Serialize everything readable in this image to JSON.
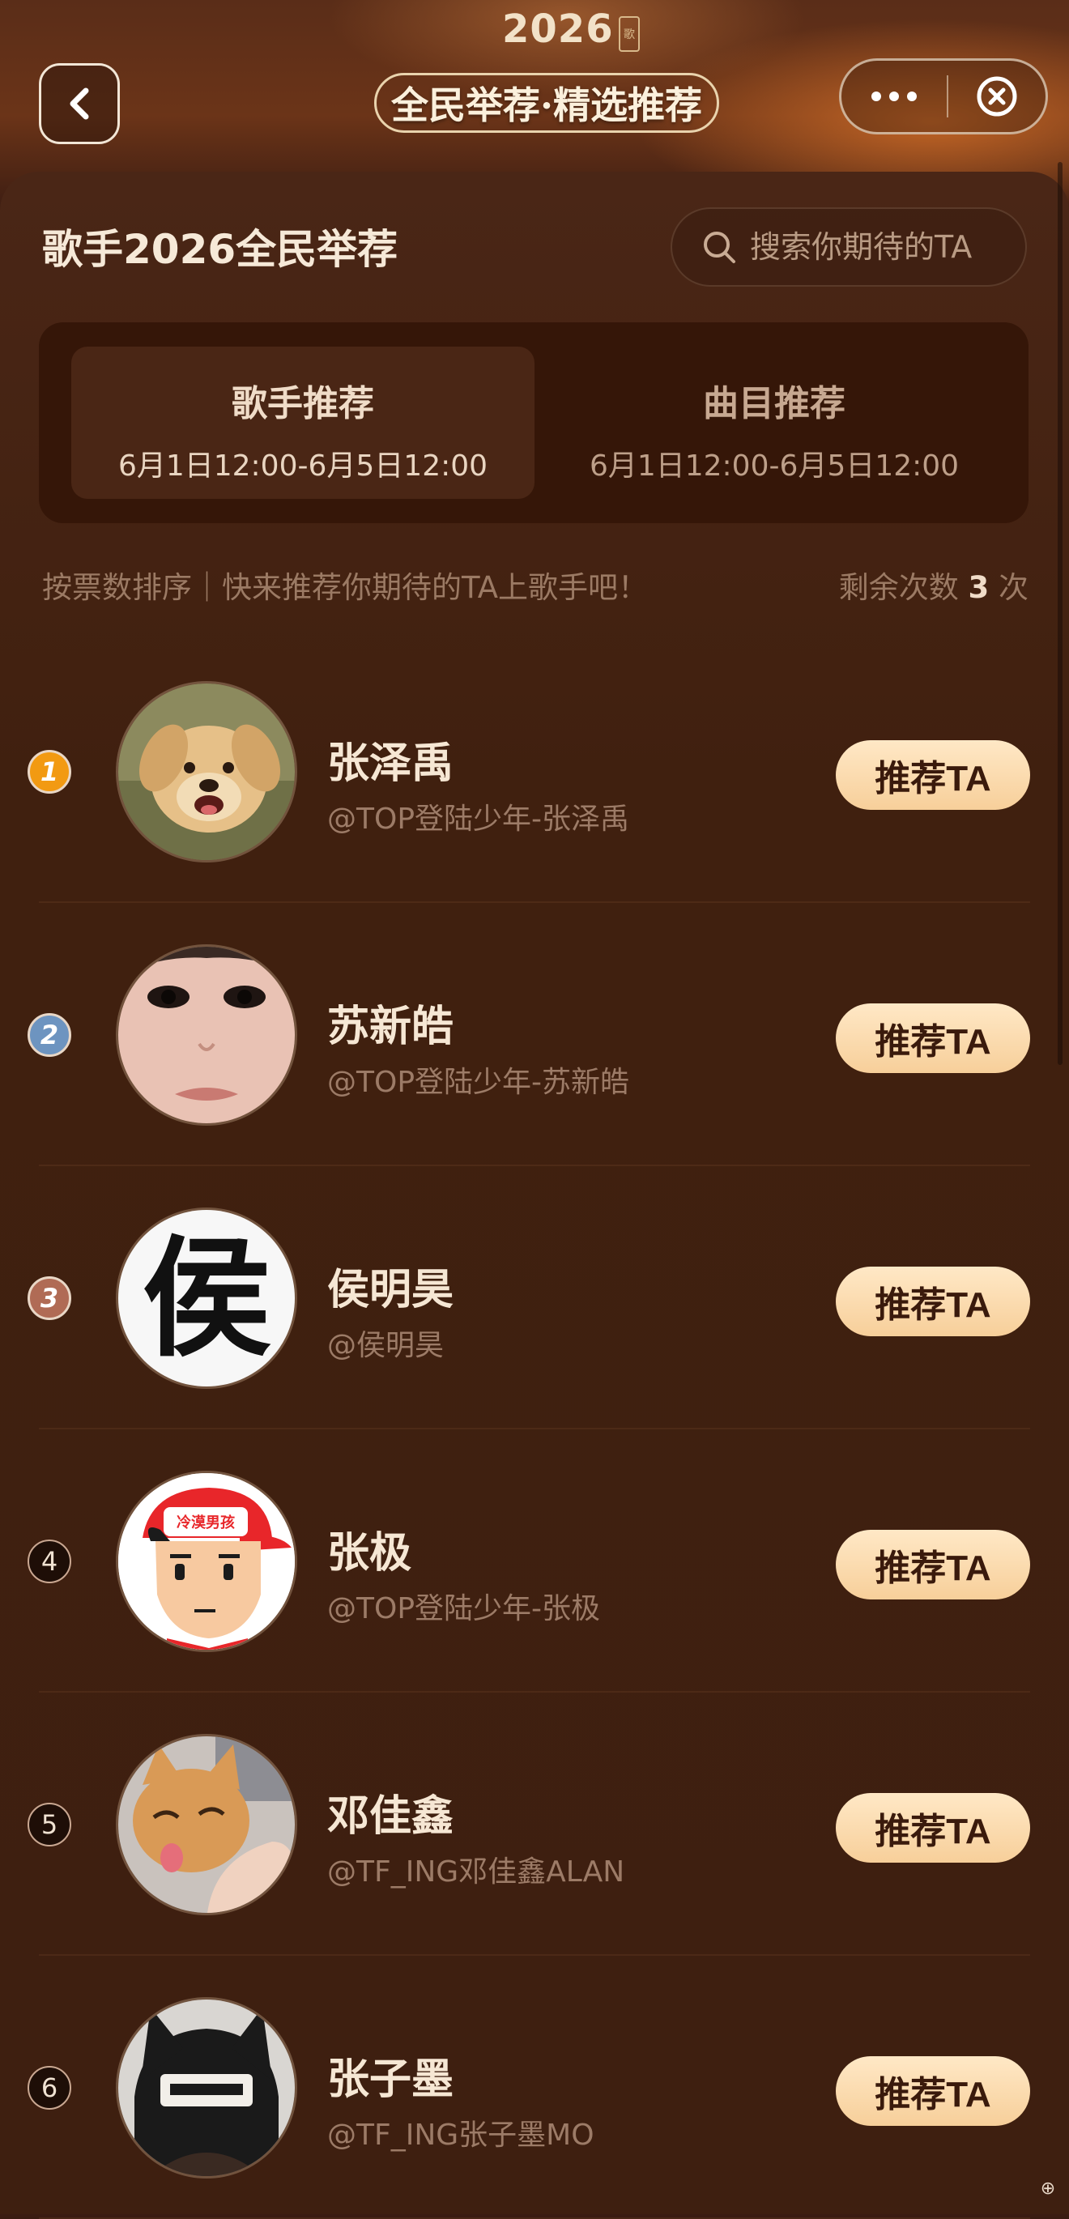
{
  "header": {
    "year": "2026",
    "year_badge": "歌",
    "title": "全民举荐·精选推荐"
  },
  "page_title": "歌手2026全民举荐",
  "search": {
    "placeholder": "搜索你期待的TA"
  },
  "tabs": [
    {
      "label": "歌手推荐",
      "dates": "6月1日12:00-6月5日12:00",
      "active": true
    },
    {
      "label": "曲目推荐",
      "dates": "6月1日12:00-6月5日12:00",
      "active": false
    }
  ],
  "hint": {
    "sort_text": "按票数排序｜快来推荐你期待的TA上歌手吧！",
    "remain_prefix": "剩余次数",
    "remain_count": "3",
    "remain_suffix": "次"
  },
  "button_label": "推荐TA",
  "candidates": [
    {
      "rank": "1",
      "name": "张泽禹",
      "handle": "@TOP登陆少年-张泽禹",
      "avatar": "puppy-avatar"
    },
    {
      "rank": "2",
      "name": "苏新皓",
      "handle": "@TOP登陆少年-苏新皓",
      "avatar": "face-avatar"
    },
    {
      "rank": "3",
      "name": "侯明昊",
      "handle": "@侯明昊",
      "avatar": "character-avatar",
      "avatar_char": "侯"
    },
    {
      "rank": "4",
      "name": "张极",
      "handle": "@TOP登陆少年-张极",
      "avatar": "cartoon-boy-avatar",
      "avatar_text": "冷漠男孩"
    },
    {
      "rank": "5",
      "name": "邓佳鑫",
      "handle": "@TF_ING邓佳鑫ALAN",
      "avatar": "cat-avatar"
    },
    {
      "rank": "6",
      "name": "张子墨",
      "handle": "@TF_ING张子墨MO",
      "avatar": "beanie-avatar"
    }
  ],
  "colors": {
    "background": "#3e1f10",
    "button_gradient_top": "#ffe8c6",
    "button_gradient_bottom": "#f7cf9a",
    "rank1": "#f29a12",
    "rank2": "#6d94c0",
    "rank3": "#b06b55"
  }
}
